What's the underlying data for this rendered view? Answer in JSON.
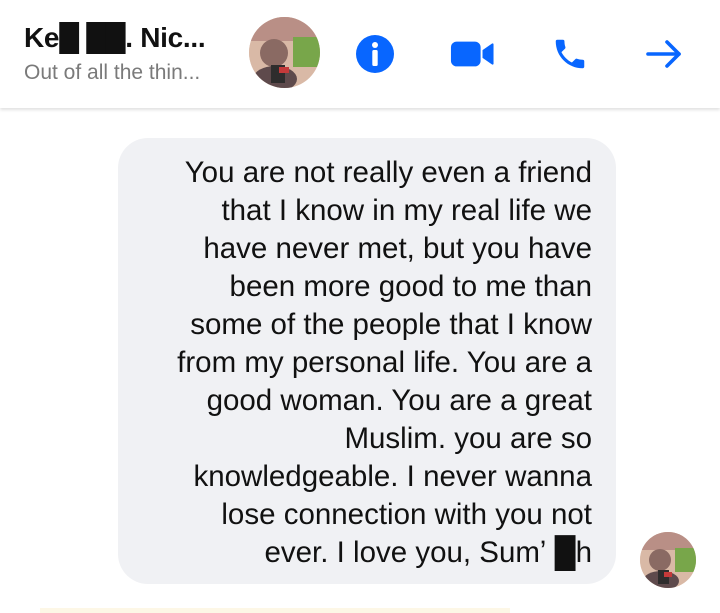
{
  "header": {
    "contact_name": "Ke█ ██. Nic...",
    "last_message_preview": "Out of all the thin...",
    "buttons": {
      "info": "info-icon",
      "video_call": "video-camera-icon",
      "voice_call": "phone-icon",
      "forward": "arrow-right-icon"
    }
  },
  "message": {
    "text": "You are not really even a friend\nthat I know in my real life we\nhave never met, but you have\nbeen more good to me than\nsome of the people that I know\nfrom my personal life. You are a\ngood woman. You are a great\nMuslim. you are so\nknowledgeable. I never wanna\nlose connection with you not\never. I love you, Sumʼ      █h"
  },
  "colors": {
    "accent": "#0866ff",
    "bubble_background": "#f0f1f4",
    "preview_text": "#7a7a7a"
  }
}
